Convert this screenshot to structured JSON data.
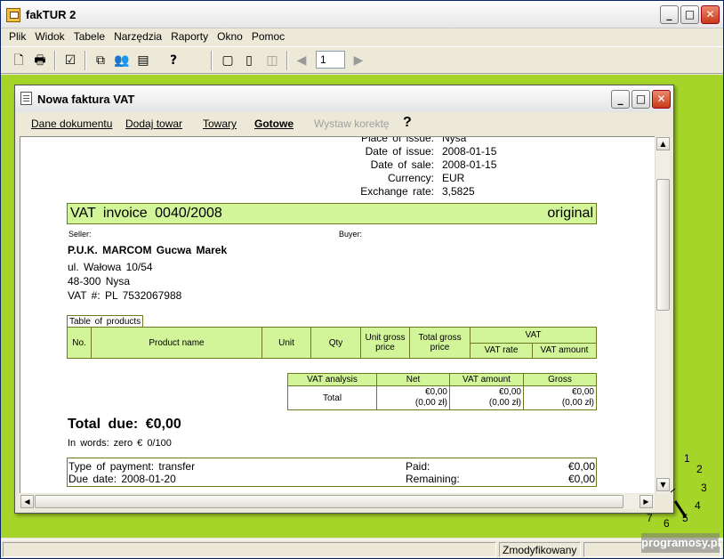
{
  "app": {
    "title": "fakTUR 2"
  },
  "menu": [
    "Plik",
    "Widok",
    "Tabele",
    "Narzędzia",
    "Raporty",
    "Okno",
    "Pomoc"
  ],
  "toolbar": {
    "page_value": "1"
  },
  "window_controls": {
    "minimize": "_",
    "maximize": "□",
    "close": "✕"
  },
  "child_window": {
    "title": "Nowa faktura VAT",
    "tabs": [
      "Dane dokumentu",
      "Dodaj towar",
      "Towary",
      "Gotowe",
      "Wystaw korektę"
    ],
    "help": "?"
  },
  "invoice": {
    "meta": [
      {
        "label": "Place of issue:",
        "value": "Nysa"
      },
      {
        "label": "Date of issue:",
        "value": "2008-01-15"
      },
      {
        "label": "Date of sale:",
        "value": "2008-01-15"
      },
      {
        "label": "Currency:",
        "value": "EUR"
      },
      {
        "label": "Exchange rate:",
        "value": "3,5825"
      }
    ],
    "title": "VAT invoice 0040/2008",
    "copy": "original",
    "seller_label": "Seller:",
    "buyer_label": "Buyer:",
    "seller_name": "P.U.K. MARCOM Gucwa Marek",
    "seller_address1": "ul. Wałowa 10/54",
    "seller_address2": "48-300 Nysa",
    "seller_vat": "VAT #: PL 7532067988",
    "products_caption": "Table of products",
    "products_headers": {
      "no": "No.",
      "name": "Product name",
      "unit": "Unit",
      "qty": "Qty",
      "unit_gross": "Unit gross price",
      "total_gross": "Total gross price",
      "vat": "VAT",
      "vat_rate": "VAT rate",
      "vat_amount": "VAT amount"
    },
    "vat_analysis": {
      "headers": [
        "VAT analysis",
        "Net",
        "VAT amount",
        "Gross"
      ],
      "row_label": "Total",
      "net": "€0,00",
      "net_pln": "(0,00 zł)",
      "vat": "€0,00",
      "vat_pln": "(0,00 zł)",
      "gross": "€0,00",
      "gross_pln": "(0,00 zł)"
    },
    "total_due_label": "Total due:",
    "total_due_value": "€0,00",
    "in_words": "In words: zero € 0/100",
    "payment_type": "Type of payment: transfer",
    "due_date": "Due date: 2008-01-20",
    "paid_label": "Paid:",
    "paid_value": "€0,00",
    "remaining_label": "Remaining:",
    "remaining_value": "€0,00"
  },
  "status": {
    "modified": "Zmodyfikowany"
  },
  "watermark": "programosy.pl",
  "callouts": [
    "1",
    "2",
    "3",
    "4",
    "5",
    "6",
    "7"
  ],
  "colors": {
    "accent_green": "#a6d52a",
    "table_green": "#d2f59a"
  }
}
